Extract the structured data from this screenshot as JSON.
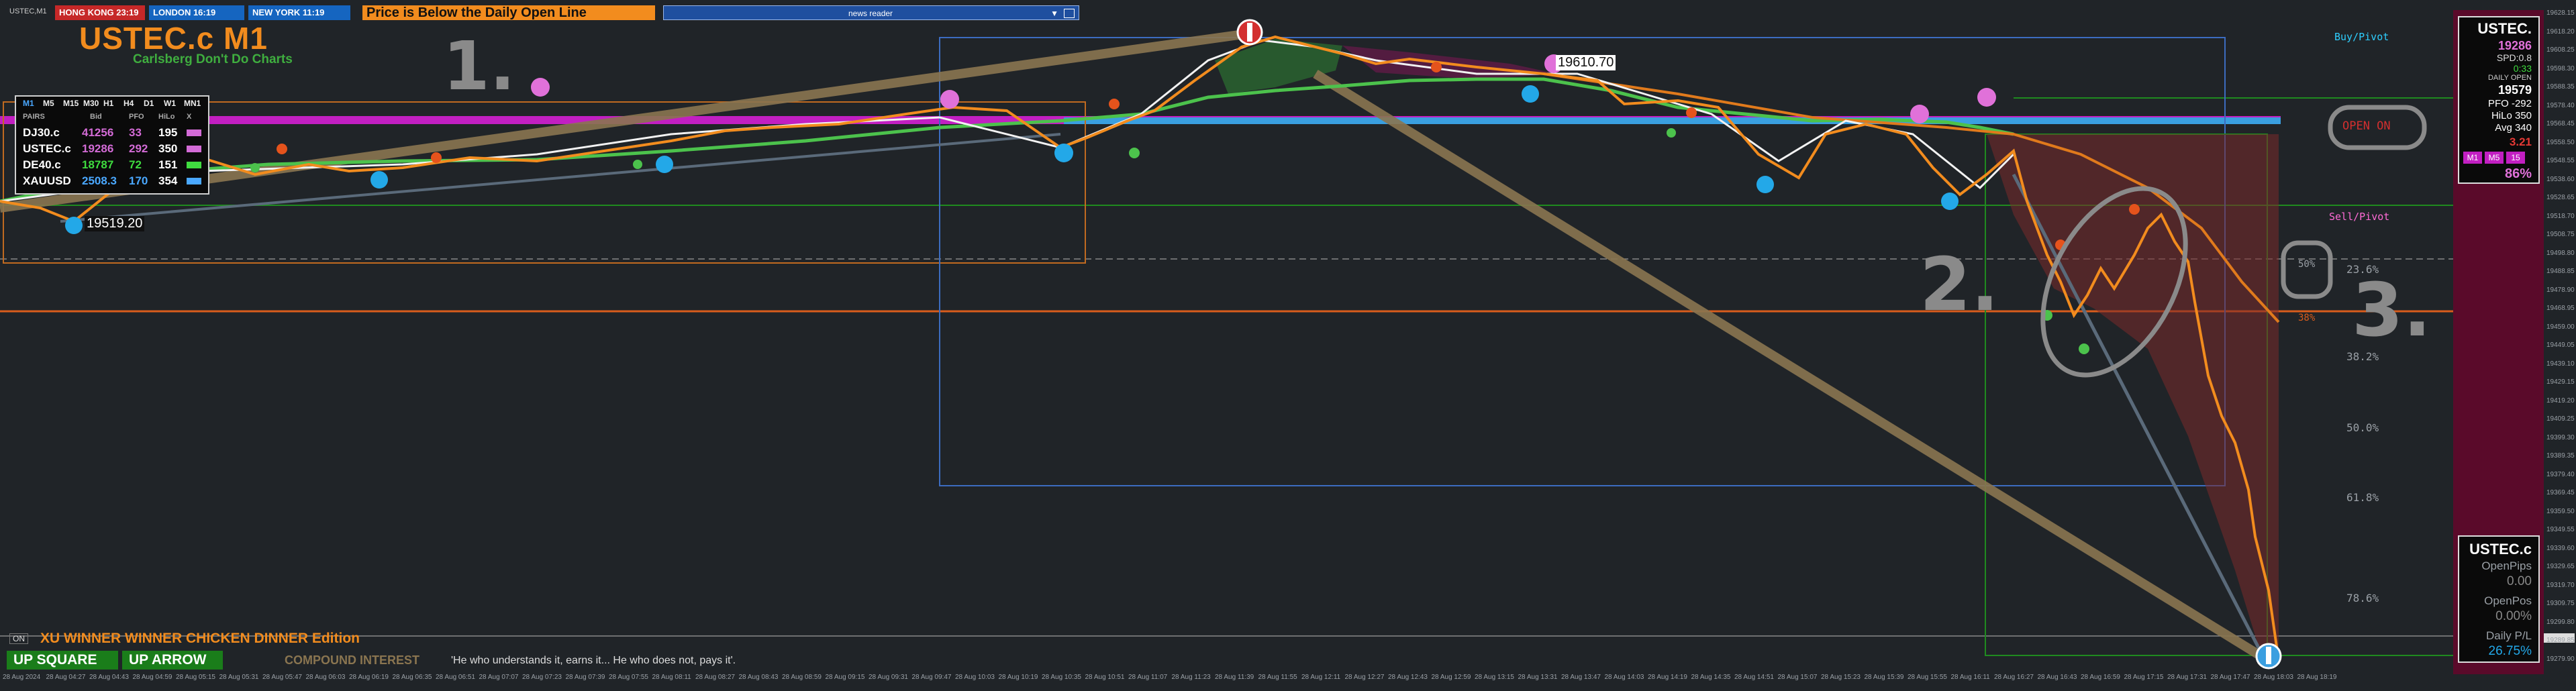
{
  "window": {
    "corner_label": "USTEC,M1"
  },
  "sessions": [
    {
      "label": "HONG KONG 23:19",
      "color": "#c62828"
    },
    {
      "label": "LONDON  16:19",
      "color": "#1565c0"
    },
    {
      "label": "NEW YORK 11:19",
      "color": "#1565c0"
    }
  ],
  "banner": {
    "text": "Price is Below the Daily Open Line",
    "color": "#f28c1e"
  },
  "news_reader": {
    "label": "news reader"
  },
  "header": {
    "symbol_title": "USTEC.c M1",
    "tagline": "Carlsberg Don't Do Charts"
  },
  "pairs_table": {
    "timeframes": [
      "M1",
      "M5",
      "M15",
      "M30",
      "H1",
      "H4",
      "D1",
      "W1",
      "MN1"
    ],
    "columns": [
      "PAIRS",
      "Bid",
      "PFO",
      "HiLo",
      "X"
    ],
    "rows": [
      {
        "pair": "DJ30.c",
        "bid": "41256",
        "pfo": "33",
        "hilo": "195",
        "bid_color": "#d36bd6",
        "pfo_color": "#d36bd6"
      },
      {
        "pair": "USTEC.c",
        "bid": "19286",
        "pfo": "292",
        "hilo": "350",
        "bid_color": "#d36bd6",
        "pfo_color": "#d36bd6"
      },
      {
        "pair": "DE40.c",
        "bid": "18787",
        "pfo": "72",
        "hilo": "151",
        "bid_color": "#3fdc3f",
        "pfo_color": "#3fdc3f"
      },
      {
        "pair": "XAUUSD",
        "bid": "2508.3",
        "pfo": "170",
        "hilo": "354",
        "bid_color": "#4aa8ff",
        "pfo_color": "#4aa8ff"
      }
    ]
  },
  "annotations": {
    "note1": "1.",
    "note2": "2.",
    "note3": "3.",
    "low_label": "19519.20",
    "high_label": "19610.70",
    "open_on": "OPEN ON"
  },
  "right_labels": {
    "buy_pivot": "Buy/Pivot",
    "sell_pivot": "Sell/Pivot"
  },
  "fib_levels": [
    "23.6%",
    "38.2%",
    "50.0%",
    "61.8%",
    "78.6%"
  ],
  "fib_small": [
    "50%",
    "38%"
  ],
  "info_panel": {
    "symbol": "USTEC.",
    "price": "19286",
    "spd": "SPD:0.8",
    "time": "0:33",
    "daily_open_label": "DAILY OPEN",
    "daily_open": "19579",
    "pfo": "PFO  -292",
    "hilo": "HiLo  350",
    "avg": "Avg   340",
    "ratio": "3.21",
    "tf_buttons": [
      "M1",
      "M5",
      "15"
    ],
    "percent": "86%"
  },
  "pl_panel": {
    "symbol": "USTEC.c",
    "open_pips_label": "OpenPips",
    "open_pips": "0.00",
    "open_pos_label": "OpenPos",
    "open_pos": "0.00%",
    "daily_pl_label": "Daily P/L",
    "daily_pl": "26.75%"
  },
  "footer": {
    "edition": "XU WINNER WINNER CHICKEN DINNER Edition",
    "up_square": "UP SQUARE",
    "up_arrow": "UP ARROW",
    "compound_title": "COMPOUND INTEREST",
    "compound_quote": "'He who understands it, earns it... He who does not, pays it'.",
    "on_label": "ON"
  },
  "time_axis": [
    "28 Aug 2024",
    "28 Aug 04:27",
    "28 Aug 04:43",
    "28 Aug 04:59",
    "28 Aug 05:15",
    "28 Aug 05:31",
    "28 Aug 05:47",
    "28 Aug 06:03",
    "28 Aug 06:19",
    "28 Aug 06:35",
    "28 Aug 06:51",
    "28 Aug 07:07",
    "28 Aug 07:23",
    "28 Aug 07:39",
    "28 Aug 07:55",
    "28 Aug 08:11",
    "28 Aug 08:27",
    "28 Aug 08:43",
    "28 Aug 08:59",
    "28 Aug 09:15",
    "28 Aug 09:31",
    "28 Aug 09:47",
    "28 Aug 10:03",
    "28 Aug 10:19",
    "28 Aug 10:35",
    "28 Aug 10:51",
    "28 Aug 11:07",
    "28 Aug 11:23",
    "28 Aug 11:39",
    "28 Aug 11:55",
    "28 Aug 12:11",
    "28 Aug 12:27",
    "28 Aug 12:43",
    "28 Aug 12:59",
    "28 Aug 13:15",
    "28 Aug 13:31",
    "28 Aug 13:47",
    "28 Aug 14:03",
    "28 Aug 14:19",
    "28 Aug 14:35",
    "28 Aug 14:51",
    "28 Aug 15:07",
    "28 Aug 15:23",
    "28 Aug 15:39",
    "28 Aug 15:55",
    "28 Aug 16:11",
    "28 Aug 16:27",
    "28 Aug 16:43",
    "28 Aug 16:59",
    "28 Aug 17:15",
    "28 Aug 17:31",
    "28 Aug 17:47",
    "28 Aug 18:03",
    "28 Aug 18:19"
  ],
  "price_axis": [
    "19628.15",
    "19618.20",
    "19608.25",
    "19598.30",
    "19588.35",
    "19578.40",
    "19568.45",
    "19558.50",
    "19548.55",
    "19538.60",
    "19528.65",
    "19518.70",
    "19508.75",
    "19498.80",
    "19488.85",
    "19478.90",
    "19468.95",
    "19459.00",
    "19449.05",
    "19439.10",
    "19429.15",
    "19419.20",
    "19409.25",
    "19399.30",
    "19389.35",
    "19379.40",
    "19369.45",
    "19359.50",
    "19349.55",
    "19339.60",
    "19329.65",
    "19319.70",
    "19309.75",
    "19299.80",
    "19289.85",
    "19279.90"
  ],
  "colors": {
    "background": "#202428",
    "candles": "#f28c1e",
    "magenta_line": "#c21fc2",
    "blue_line": "#3a9fe0",
    "trend_line": "#8a7550",
    "box_blue": "#3c6cc0",
    "box_orange": "#c06a20"
  }
}
